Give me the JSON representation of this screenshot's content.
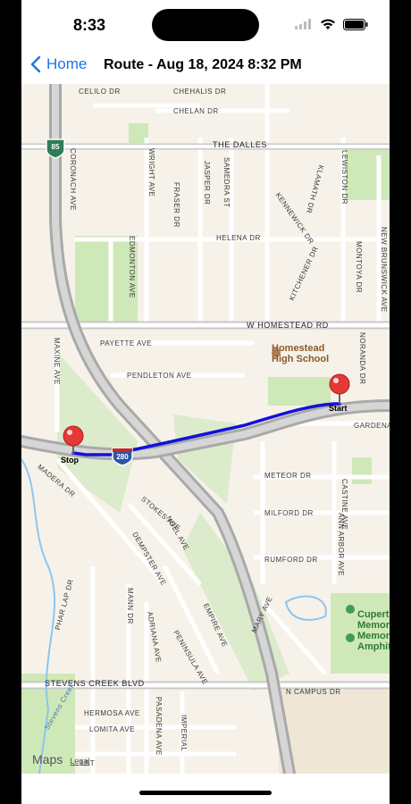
{
  "status_bar": {
    "time": "8:33"
  },
  "nav": {
    "back_label": "Home",
    "title": "Route - Aug 18, 2024 8:32 PM"
  },
  "map": {
    "road_labels": [
      "CELILO DR",
      "CHEHALIS DR",
      "CHELAN DR",
      "THE DALLES",
      "CORONACH AVE",
      "WRIGHT AVE",
      "JASPER DR",
      "FRASER DR",
      "SAMEDRA ST",
      "KENNEWICK DR",
      "KLAMATH DR",
      "LEWISTON DR",
      "NEW BRUNSWICK AVE",
      "EDMONTON AVE",
      "HELENA DR",
      "KITCHENER DR",
      "MONTOYA DR",
      "W HOMESTEAD RD",
      "PAYETTE AVE",
      "MAXINE AVE",
      "PENDLETON AVE",
      "NORANDA DR",
      "GARDENA",
      "METEOR DR",
      "CASTINE AVE",
      "MILFORD DR",
      "ANN ARBOR AVE",
      "RUMFORD DR",
      "MADERA DR",
      "STOKES AVE",
      "NOEL AVE",
      "DEMPSTER AVE",
      "EMPIRE AVE",
      "MANN DR",
      "PHAR LAP DR",
      "ADRIANA AVE",
      "PENINSULA AVE",
      "MARY AVE",
      "STEVENS CREEK BLVD",
      "N CAMPUS DR",
      "HERMOSA AVE",
      "PASADENA AVE",
      "IMPERIAL",
      "LOMITA AVE",
      "LBT",
      "Legal"
    ],
    "poi": {
      "school": [
        "Homestead",
        "High School"
      ],
      "memorial": [
        "Cupertino",
        "Memor",
        "Memor",
        "Amphit"
      ]
    },
    "shields": {
      "highway_85": "85",
      "interstate_280": "280"
    },
    "creek": "Stevens Creek",
    "start_label": "Start",
    "stop_label": "Stop",
    "attribution": "Maps",
    "colors": {
      "route": "#1212d8",
      "pin": "#e53935",
      "park": "#cfe8b8",
      "highway": "#b9b9b9",
      "map_bg": "#f6f2ea"
    }
  }
}
